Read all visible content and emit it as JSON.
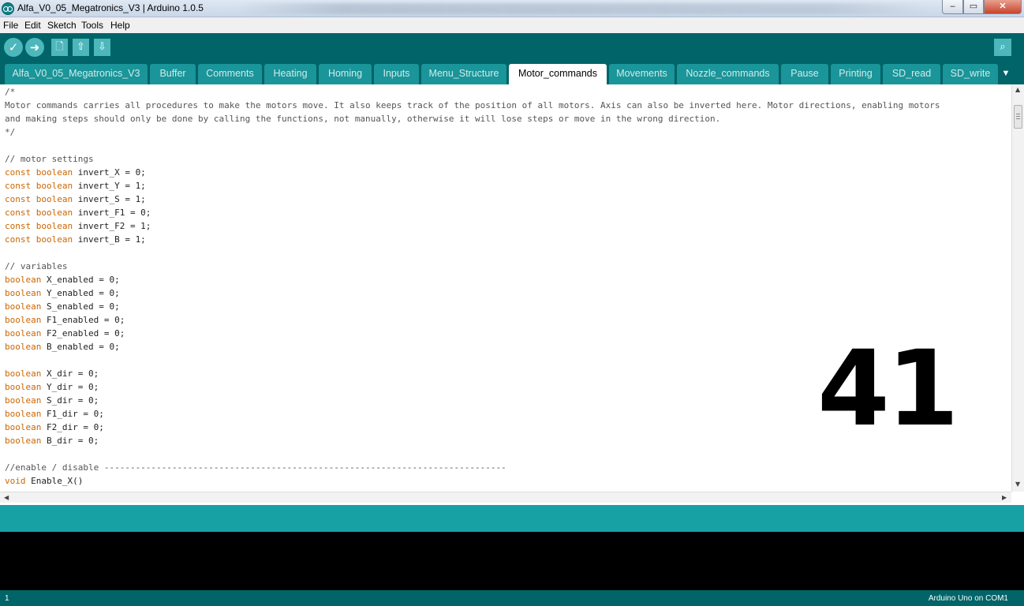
{
  "window": {
    "title": "Alfa_V0_05_Megatronics_V3 | Arduino 1.0.5",
    "controls": {
      "minimize": "–",
      "maximize": "▭",
      "close": "✕"
    }
  },
  "menu": [
    "File",
    "Edit",
    "Sketch",
    "Tools",
    "Help"
  ],
  "toolbar": {
    "verify_icon": "✓",
    "upload_icon": "➜",
    "new_icon": "🗋",
    "open_icon": "⇧",
    "save_icon": "⇩",
    "serial_monitor_icon": "⌕"
  },
  "tabs": [
    {
      "label": "Alfa_V0_05_Megatronics_V3"
    },
    {
      "label": "Buffer"
    },
    {
      "label": "Comments"
    },
    {
      "label": "Heating"
    },
    {
      "label": "Homing"
    },
    {
      "label": "Inputs"
    },
    {
      "label": "Menu_Structure"
    },
    {
      "label": "Motor_commands",
      "active": true
    },
    {
      "label": "Movements"
    },
    {
      "label": "Nozzle_commands"
    },
    {
      "label": "Pause"
    },
    {
      "label": "Printing"
    },
    {
      "label": "SD_read"
    },
    {
      "label": "SD_write"
    }
  ],
  "tab_menu_icon": "▼",
  "editor": {
    "lines": [
      [
        [
          "cm",
          "/*"
        ]
      ],
      [
        [
          "cm",
          "Motor commands carries all procedures to make the motors move. It also keeps track of the position of all motors. Axis can also be inverted here. Motor directions, enabling motors"
        ]
      ],
      [
        [
          "cm",
          "and making steps should only be done by calling the functions, not manually, otherwise it will lose steps or move in the wrong direction."
        ]
      ],
      [
        [
          "cm",
          "*/"
        ]
      ],
      [],
      [
        [
          "cm",
          "// motor settings"
        ]
      ],
      [
        [
          "kw",
          "const boolean"
        ],
        [
          "tx",
          " invert_X = 0;"
        ]
      ],
      [
        [
          "kw",
          "const boolean"
        ],
        [
          "tx",
          " invert_Y = 1;"
        ]
      ],
      [
        [
          "kw",
          "const boolean"
        ],
        [
          "tx",
          " invert_S = 1;"
        ]
      ],
      [
        [
          "kw",
          "const boolean"
        ],
        [
          "tx",
          " invert_F1 = 0;"
        ]
      ],
      [
        [
          "kw",
          "const boolean"
        ],
        [
          "tx",
          " invert_F2 = 1;"
        ]
      ],
      [
        [
          "kw",
          "const boolean"
        ],
        [
          "tx",
          " invert_B = 1;"
        ]
      ],
      [],
      [
        [
          "cm",
          "// variables"
        ]
      ],
      [
        [
          "kw",
          "boolean"
        ],
        [
          "tx",
          " X_enabled = 0;"
        ]
      ],
      [
        [
          "kw",
          "boolean"
        ],
        [
          "tx",
          " Y_enabled = 0;"
        ]
      ],
      [
        [
          "kw",
          "boolean"
        ],
        [
          "tx",
          " S_enabled = 0;"
        ]
      ],
      [
        [
          "kw",
          "boolean"
        ],
        [
          "tx",
          " F1_enabled = 0;"
        ]
      ],
      [
        [
          "kw",
          "boolean"
        ],
        [
          "tx",
          " F2_enabled = 0;"
        ]
      ],
      [
        [
          "kw",
          "boolean"
        ],
        [
          "tx",
          " B_enabled = 0;"
        ]
      ],
      [],
      [
        [
          "kw",
          "boolean"
        ],
        [
          "tx",
          " X_dir = 0;"
        ]
      ],
      [
        [
          "kw",
          "boolean"
        ],
        [
          "tx",
          " Y_dir = 0;"
        ]
      ],
      [
        [
          "kw",
          "boolean"
        ],
        [
          "tx",
          " S_dir = 0;"
        ]
      ],
      [
        [
          "kw",
          "boolean"
        ],
        [
          "tx",
          " F1_dir = 0;"
        ]
      ],
      [
        [
          "kw",
          "boolean"
        ],
        [
          "tx",
          " F2_dir = 0;"
        ]
      ],
      [
        [
          "kw",
          "boolean"
        ],
        [
          "tx",
          " B_dir = 0;"
        ]
      ],
      [],
      [
        [
          "cm",
          "//enable / disable -----------------------------------------------------------------------------"
        ]
      ],
      [
        [
          "kw",
          "void"
        ],
        [
          "tx",
          " Enable_X()"
        ]
      ]
    ]
  },
  "overlay_number": "41",
  "scrollbars": {
    "up": "▲",
    "down": "▼",
    "left": "◀",
    "right": "▶"
  },
  "status": {
    "line_number": "1",
    "board": "Arduino Uno on COM1"
  },
  "colors": {
    "toolbar": "#006468",
    "tab": "#1a9599",
    "status_bar": "#17a1a5",
    "keyword": "#cc6600",
    "console": "#000000"
  }
}
